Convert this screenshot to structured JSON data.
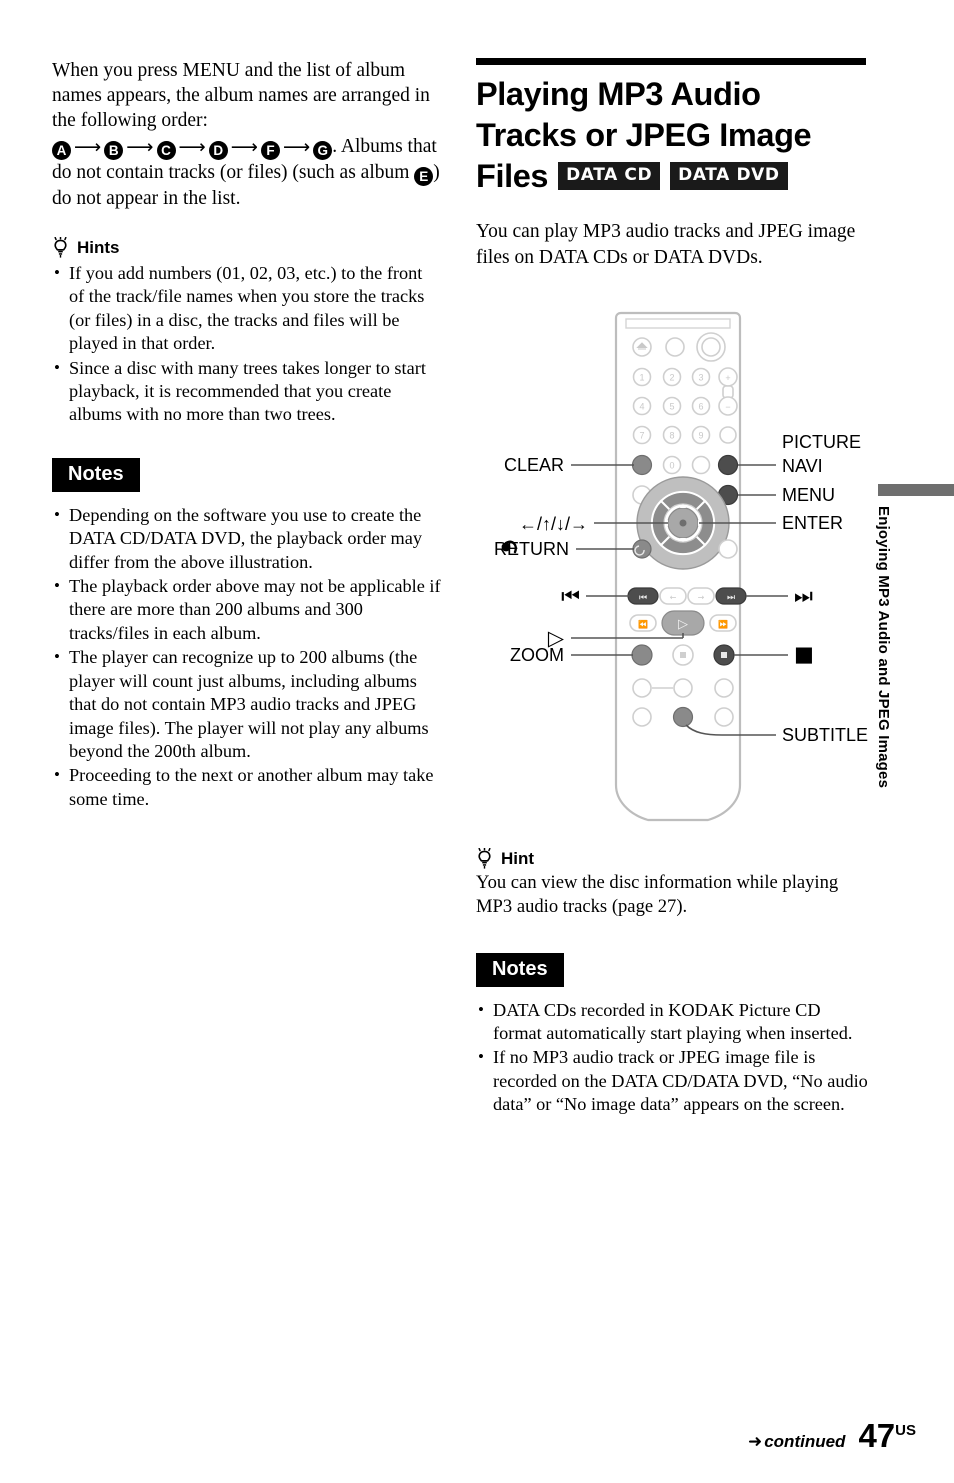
{
  "left_column": {
    "intro_paragraph_part1": "When you press MENU and the list of album names appears, the album names are arranged in the following order:",
    "album_chain": [
      "A",
      "B",
      "C",
      "D",
      "F",
      "G"
    ],
    "intro_paragraph_part2_a": ". Albums that do not contain tracks (or files) (such as album ",
    "album_excluded": "E",
    "intro_paragraph_part2_b": ") do not appear in the list.",
    "hints_heading": "Hints",
    "hints_icon": "lightbulb-icon",
    "hints": [
      "If you add numbers (01, 02, 03, etc.) to the front of the track/file names when you store the tracks (or files) in a disc, the tracks and files will be played in that order.",
      "Since a disc with many trees takes longer to start playback, it is recommended that you create albums with no more than two trees."
    ],
    "notes_heading": "Notes",
    "notes": [
      "Depending on the software you use to create the DATA CD/DATA DVD, the playback order may differ from the above illustration.",
      "The playback order above may not be applicable if there are more than 200 albums and 300 tracks/files in each album.",
      "The player can recognize up to 200 albums (the player will count just albums, including albums that do not contain MP3 audio tracks and JPEG image files). The player will not play any albums beyond the 200th album.",
      "Proceeding to the next or another album may take some time."
    ]
  },
  "right_column": {
    "title_line1": "Playing MP3 Audio",
    "title_line2": "Tracks or JPEG Image",
    "title_line3": "Files",
    "badges": [
      "DATA CD",
      "DATA DVD"
    ],
    "intro": "You can play MP3 audio tracks and JPEG image files on DATA CDs or DATA DVDs.",
    "hint_heading": "Hint",
    "hint_icon": "lightbulb-icon",
    "hint_text": "You can view the disc information while playing MP3 audio tracks (page 27).",
    "notes_heading": "Notes",
    "notes": [
      "DATA CDs recorded in KODAK Picture CD format automatically start playing when inserted.",
      "If no MP3 audio track or JPEG image file is recorded on the DATA CD/DATA DVD, “No audio data” or “No image data” appears on the screen."
    ]
  },
  "remote_figure": {
    "labels_left": [
      {
        "name": "clear",
        "text": "CLEAR"
      },
      {
        "name": "direction-pad",
        "text": "←/↑/↓/→"
      },
      {
        "name": "return",
        "text": "RETURN",
        "icon": "return-arrow-icon"
      },
      {
        "name": "prev-track",
        "text": "⏮",
        "glyph": true
      },
      {
        "name": "play",
        "text": "▷",
        "glyph": true
      },
      {
        "name": "zoom",
        "text": "ZOOM"
      }
    ],
    "labels_right": [
      {
        "name": "picture-navi",
        "line1": "PICTURE",
        "line2": "NAVI"
      },
      {
        "name": "menu",
        "text": "MENU"
      },
      {
        "name": "enter",
        "text": "ENTER"
      },
      {
        "name": "next-track",
        "text": "⏭",
        "glyph": true
      },
      {
        "name": "stop",
        "text": "■",
        "glyph": true
      },
      {
        "name": "subtitle",
        "text": "SUBTITLE"
      }
    ],
    "keypad_numbers": [
      "1",
      "2",
      "3",
      "4",
      "5",
      "6",
      "7",
      "8",
      "9",
      "0"
    ],
    "volume_plus": "+",
    "volume_minus": "−"
  },
  "side_tab": {
    "text": "Enjoying MP3 Audio and JPEG Images",
    "color": "#6e6e6e"
  },
  "footer": {
    "continued": "continued",
    "continued_arrow": "➜",
    "page_number": "47",
    "page_suffix": "US"
  }
}
